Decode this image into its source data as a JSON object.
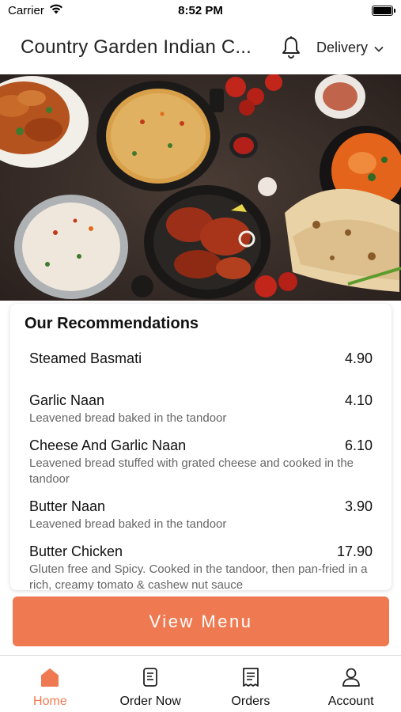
{
  "status_bar": {
    "carrier": "Carrier",
    "time": "8:52 PM"
  },
  "header": {
    "title": "Country Garden Indian C...",
    "delivery_label": "Delivery"
  },
  "recommendations": {
    "title": "Our Recommendations",
    "items": [
      {
        "name": "Steamed Basmati",
        "price": "4.90",
        "description": ""
      },
      {
        "name": "Garlic Naan",
        "price": "4.10",
        "description": "Leavened bread baked in the tandoor"
      },
      {
        "name": "Cheese And Garlic Naan",
        "price": "6.10",
        "description": "Leavened bread stuffed with grated cheese and cooked in the tandoor"
      },
      {
        "name": "Butter Naan",
        "price": "3.90",
        "description": "Leavened bread baked in the tandoor"
      },
      {
        "name": "Butter Chicken",
        "price": "17.90",
        "description": "Gluten free and Spicy. Cooked in the tandoor, then pan-fried in a rich, creamy tomato & cashew nut sauce"
      }
    ]
  },
  "view_menu_label": "View Menu",
  "tabs": [
    {
      "label": "Home",
      "icon": "home-icon",
      "active": true
    },
    {
      "label": "Order Now",
      "icon": "order-icon",
      "active": false
    },
    {
      "label": "Orders",
      "icon": "receipt-icon",
      "active": false
    },
    {
      "label": "Account",
      "icon": "user-icon",
      "active": false
    }
  ],
  "colors": {
    "accent": "#ef7a52"
  }
}
